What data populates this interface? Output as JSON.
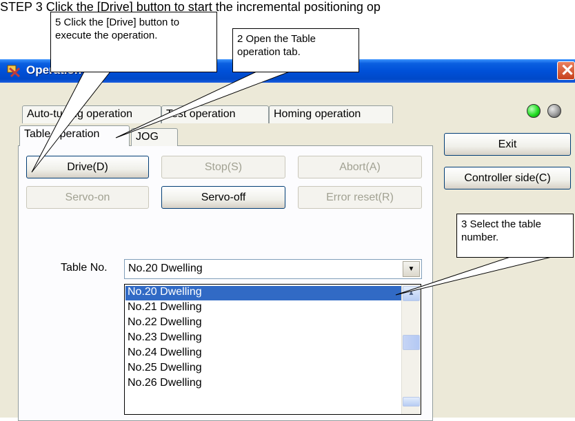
{
  "step_text": "STEP 3   Click the [Drive] button to start the incremental positioning op",
  "window": {
    "title": "Operation",
    "close_label": "✕"
  },
  "tabs_back": [
    "Auto-tuning operation",
    "Test operation",
    "Homing operation"
  ],
  "tabs_front": [
    "Table operation",
    "JOG"
  ],
  "buttons": {
    "drive": "Drive(D)",
    "stop": "Stop(S)",
    "abort": "Abort(A)",
    "servo_on": "Servo-on",
    "servo_off": "Servo-off",
    "error_reset": "Error reset(R)",
    "exit": "Exit",
    "controller_side": "Controller side(C)"
  },
  "indicators": {
    "led1_color": "#22DD22",
    "led2_color": "#9A9A9A"
  },
  "table": {
    "label": "Table No.",
    "selected": "No.20 Dwelling",
    "options": [
      "No.20 Dwelling",
      "No.21 Dwelling",
      "No.22 Dwelling",
      "No.23 Dwelling",
      "No.24 Dwelling",
      "No.25 Dwelling",
      "No.26 Dwelling"
    ]
  },
  "callouts": {
    "c5": "5 Click the [Drive] button to execute the operation.",
    "c2": "2 Open the Table operation tab.",
    "c3": "3 Select the table number."
  },
  "icons": {
    "title": "app-icon",
    "close": "close-icon",
    "dropdown": "chevron-down-icon"
  }
}
